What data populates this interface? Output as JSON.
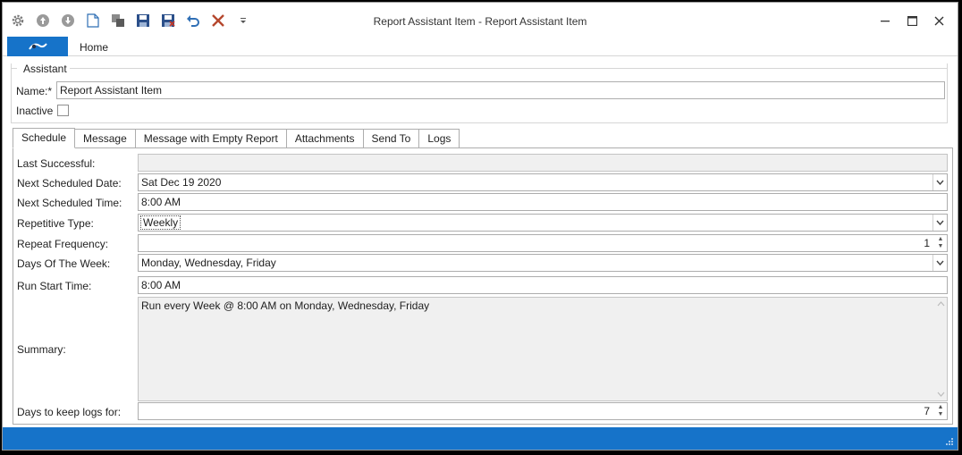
{
  "window": {
    "title": "Report Assistant Item - Report Assistant Item"
  },
  "quick_access": [
    "gear-icon",
    "up-circle-icon",
    "down-circle-icon",
    "new-document-icon",
    "copy-icon",
    "save-icon",
    "save-close-icon",
    "undo-icon",
    "delete-icon",
    "customize-dropdown-icon"
  ],
  "ribbon": {
    "home_tab": "Home"
  },
  "assistant_group": {
    "legend": "Assistant",
    "name_label": "Name:*",
    "name_value": "Report Assistant Item",
    "inactive_label": "Inactive",
    "inactive_checked": false
  },
  "tabs": [
    "Schedule",
    "Message",
    "Message with Empty Report",
    "Attachments",
    "Send To",
    "Logs"
  ],
  "active_tab": "Schedule",
  "schedule": {
    "last_successful_label": "Last Successful:",
    "last_successful_value": "",
    "next_date_label": "Next Scheduled Date:",
    "next_date_value": "Sat Dec 19 2020",
    "next_time_label": "Next Scheduled Time:",
    "next_time_value": "8:00 AM",
    "repetitive_type_label": "Repetitive Type:",
    "repetitive_type_value": "Weekly",
    "repeat_frequency_label": "Repeat Frequency:",
    "repeat_frequency_value": "1",
    "days_of_week_label": "Days Of The Week:",
    "days_of_week_value": "Monday, Wednesday, Friday",
    "run_start_label": "Run Start Time:",
    "run_start_value": "8:00 AM",
    "summary_label": "Summary:",
    "summary_value": "Run every Week @ 8:00 AM on Monday, Wednesday, Friday",
    "days_keep_logs_label": "Days to keep logs for:",
    "days_keep_logs_value": "7"
  },
  "colors": {
    "accent": "#1673c9",
    "delete_red": "#c0392b"
  }
}
